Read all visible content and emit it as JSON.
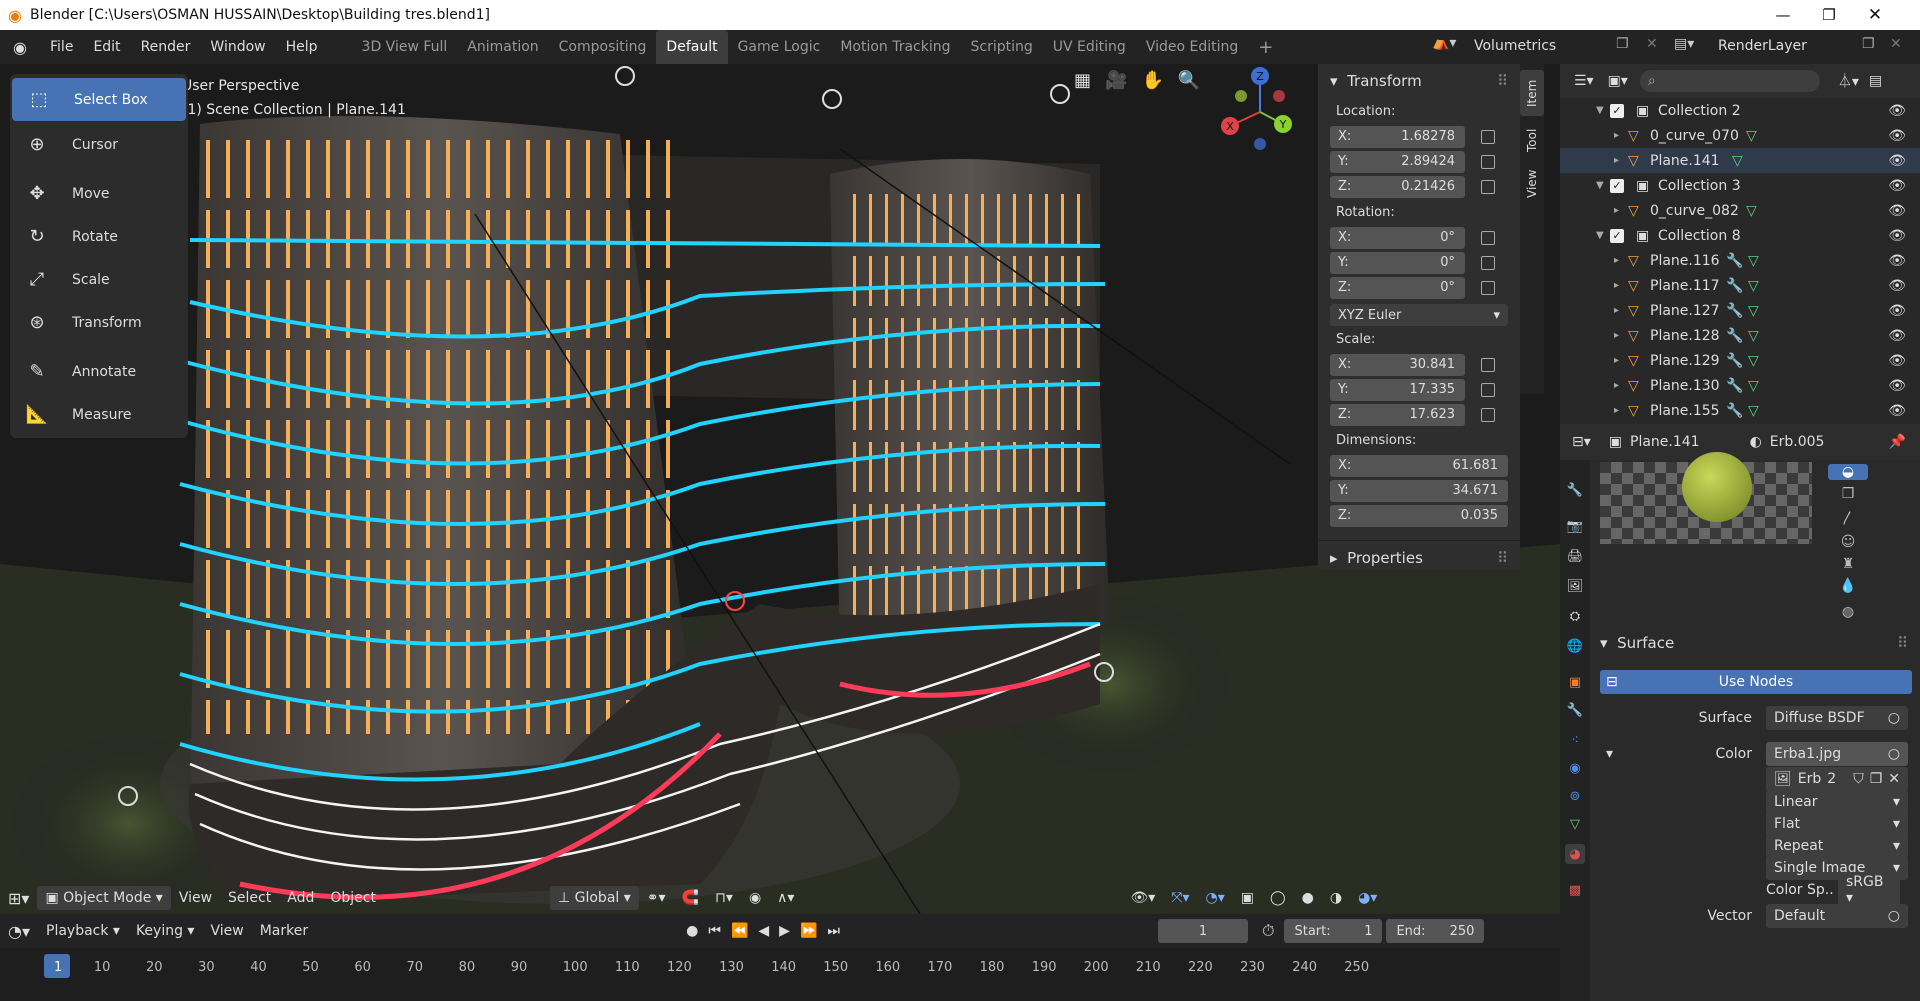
{
  "window": {
    "title": "Blender [C:\\Users\\OSMAN HUSSAIN\\Desktop\\Building tres.blend1]",
    "minimize": "—",
    "maximize": "❐",
    "close": "✕"
  },
  "menu": [
    "File",
    "Edit",
    "Render",
    "Window",
    "Help"
  ],
  "workspaces": [
    "3D View Full",
    "Animation",
    "Compositing",
    "Default",
    "Game Logic",
    "Motion Tracking",
    "Scripting",
    "UV Editing",
    "Video Editing"
  ],
  "active_workspace": "Default",
  "scene": {
    "name": "Volumetrics",
    "layer": "RenderLayer"
  },
  "viewport": {
    "perspective": "User Perspective",
    "collection": "(1) Scene Collection | Plane.141"
  },
  "tools": [
    "Select Box",
    "Cursor",
    "Move",
    "Rotate",
    "Scale",
    "Transform",
    "Annotate",
    "Measure"
  ],
  "npanel": {
    "header": "Transform",
    "location_label": "Location:",
    "location": {
      "x": "1.68278",
      "y": "2.89424",
      "z": "0.21426"
    },
    "rotation_label": "Rotation:",
    "rotation": {
      "x": "0°",
      "y": "0°",
      "z": "0°"
    },
    "euler": "XYZ Euler",
    "scale_label": "Scale:",
    "scale": {
      "x": "30.841",
      "y": "17.335",
      "z": "17.623"
    },
    "dimensions_label": "Dimensions:",
    "dimensions": {
      "x": "61.681",
      "y": "34.671",
      "z": "0.035"
    },
    "properties": "Properties",
    "tabs": [
      "Item",
      "Tool",
      "View"
    ]
  },
  "axis": {
    "x": "X",
    "y": "Y",
    "z": "Z"
  },
  "vp_bottom": {
    "mode": "Object Mode",
    "menus": [
      "View",
      "Select",
      "Add",
      "Object"
    ],
    "orientation": "Global"
  },
  "timeline": {
    "menus": [
      "Playback",
      "Keying",
      "View",
      "Marker"
    ],
    "current": "1",
    "start_label": "Start:",
    "start": "1",
    "end_label": "End:",
    "end": "250",
    "ticks": [
      "1",
      "10",
      "20",
      "30",
      "40",
      "50",
      "60",
      "70",
      "80",
      "90",
      "100",
      "110",
      "120",
      "130",
      "140",
      "150",
      "160",
      "170",
      "180",
      "190",
      "200",
      "210",
      "220",
      "230",
      "240",
      "250"
    ]
  },
  "outliner": {
    "search": "",
    "rows": [
      {
        "name": "Collection 2",
        "type": "collection",
        "indent": 0
      },
      {
        "name": "0_curve_070",
        "type": "curve",
        "indent": 1
      },
      {
        "name": "Plane.141",
        "type": "mesh",
        "indent": 1
      },
      {
        "name": "Collection 3",
        "type": "collection",
        "indent": 0
      },
      {
        "name": "0_curve_082",
        "type": "curve",
        "indent": 1
      },
      {
        "name": "Collection 8",
        "type": "collection",
        "indent": 0
      },
      {
        "name": "Plane.116",
        "type": "mesh",
        "indent": 1
      },
      {
        "name": "Plane.117",
        "type": "mesh",
        "indent": 1
      },
      {
        "name": "Plane.127",
        "type": "mesh",
        "indent": 1
      },
      {
        "name": "Plane.128",
        "type": "mesh",
        "indent": 1
      },
      {
        "name": "Plane.129",
        "type": "mesh",
        "indent": 1
      },
      {
        "name": "Plane.130",
        "type": "mesh",
        "indent": 1
      },
      {
        "name": "Plane.155",
        "type": "mesh",
        "indent": 1
      }
    ]
  },
  "properties": {
    "object": "Plane.141",
    "material": "Erb.005",
    "surface_header": "Surface",
    "use_nodes": "Use Nodes",
    "surface_label": "Surface",
    "surface_value": "Diffuse BSDF",
    "color_label": "Color",
    "color_value": "Erba1.jpg",
    "image_name": "Erb",
    "image_users": "2",
    "interp": "Linear",
    "proj": "Flat",
    "ext": "Repeat",
    "source": "Single Image",
    "colorspace_label": "Color Sp..",
    "colorspace": "sRGB",
    "vector_label": "Vector",
    "vector": "Default"
  }
}
